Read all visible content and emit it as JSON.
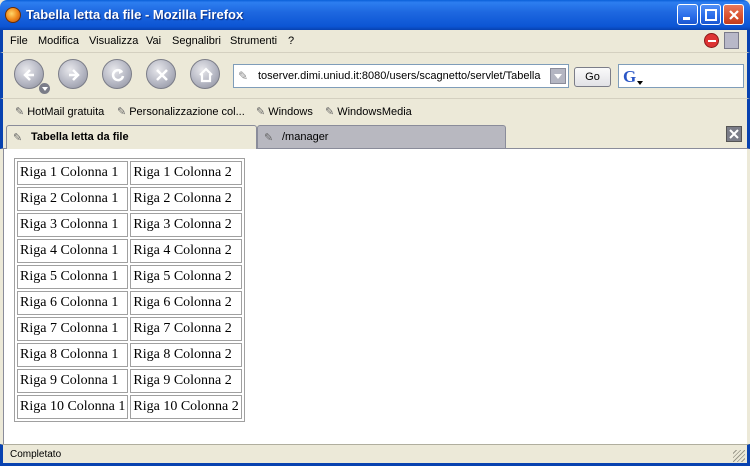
{
  "window": {
    "title": "Tabella letta da file - Mozilla Firefox"
  },
  "menu": {
    "items": [
      "File",
      "Modifica",
      "Visualizza",
      "Vai",
      "Segnalibri",
      "Strumenti",
      "?"
    ]
  },
  "navigation": {
    "url": "toserver.dimi.uniud.it:8080/users/scagnetto/servlet/Tabella",
    "go_label": "Go",
    "search_placeholder": ""
  },
  "bookmarks": {
    "items": [
      "HotMail gratuita",
      "Personalizzazione col...",
      "Windows",
      "WindowsMedia"
    ]
  },
  "tabs": [
    {
      "label": "Tabella letta da file",
      "active": true
    },
    {
      "label": "/manager",
      "active": false
    }
  ],
  "table": {
    "rows": [
      [
        "Riga 1 Colonna 1",
        "Riga 1 Colonna 2"
      ],
      [
        "Riga 2 Colonna 1",
        "Riga 2 Colonna 2"
      ],
      [
        "Riga 3 Colonna 1",
        "Riga 3 Colonna 2"
      ],
      [
        "Riga 4 Colonna 1",
        "Riga 4 Colonna 2"
      ],
      [
        "Riga 5 Colonna 1",
        "Riga 5 Colonna 2"
      ],
      [
        "Riga 6 Colonna 1",
        "Riga 6 Colonna 2"
      ],
      [
        "Riga 7 Colonna 1",
        "Riga 7 Colonna 2"
      ],
      [
        "Riga 8 Colonna 1",
        "Riga 8 Colonna 2"
      ],
      [
        "Riga 9 Colonna 1",
        "Riga 9 Colonna 2"
      ],
      [
        "Riga 10 Colonna 1",
        "Riga 10 Colonna 2"
      ]
    ]
  },
  "status": {
    "text": "Completato"
  },
  "colors": {
    "title_bar": "#0c55d4",
    "chrome": "#ece9d8",
    "close_button": "#d9502f"
  },
  "icons": {
    "app": "firefox-icon",
    "back": "back-arrow-icon",
    "forward": "forward-arrow-icon",
    "reload": "reload-icon",
    "stop": "stop-icon",
    "home": "home-icon",
    "search_engine": "google-icon"
  }
}
